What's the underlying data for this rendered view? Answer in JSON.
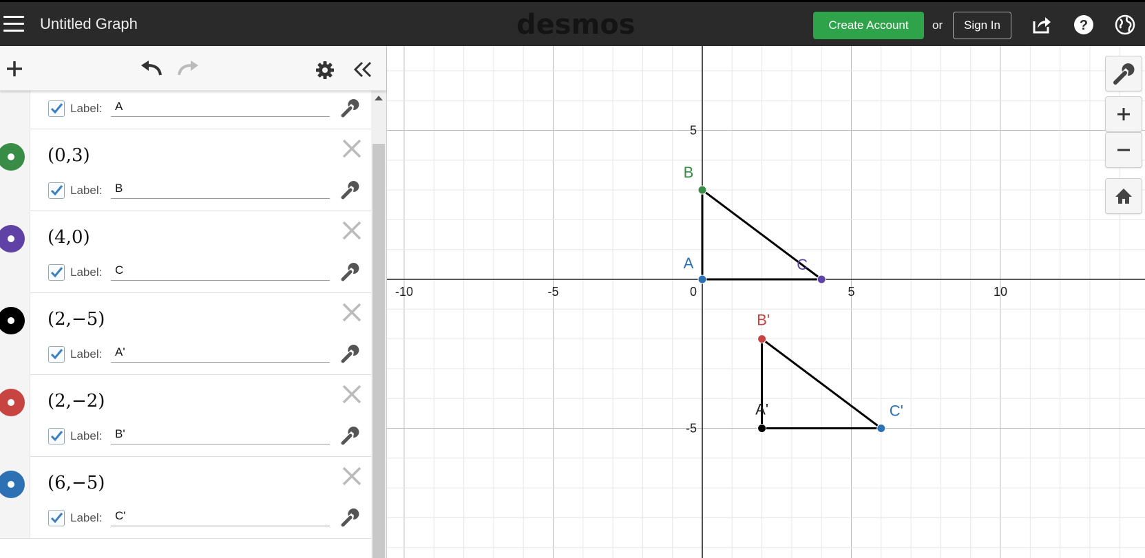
{
  "header": {
    "title": "Untitled Graph",
    "logo": "desmos",
    "create_account": "Create Account",
    "or": "or",
    "sign_in": "Sign In",
    "icons": [
      "menu-icon",
      "share-icon",
      "help-icon",
      "globe-icon"
    ]
  },
  "toolbar": {
    "icons": [
      "add-icon",
      "undo-icon",
      "redo-icon",
      "settings-icon",
      "collapse-icon"
    ]
  },
  "expressions": [
    {
      "expr": "",
      "label_text": "Label:",
      "label": "A",
      "color": "#2d70b3",
      "checked": true,
      "partial": true
    },
    {
      "expr": "(0,3)",
      "label_text": "Label:",
      "label": "B",
      "color": "#388c46",
      "checked": true
    },
    {
      "expr": "(4,0)",
      "label_text": "Label:",
      "label": "C",
      "color": "#6042a6",
      "checked": true
    },
    {
      "expr": "(2,−5)",
      "label_text": "Label:",
      "label": "A'",
      "color": "#000000",
      "checked": true
    },
    {
      "expr": "(2,−2)",
      "label_text": "Label:",
      "label": "B'",
      "color": "#c74440",
      "checked": true
    },
    {
      "expr": "(6,−5)",
      "label_text": "Label:",
      "label": "C'",
      "color": "#2d70b3",
      "checked": true
    }
  ],
  "graph": {
    "x_ticks": [
      "-10",
      "-5",
      "0",
      "5",
      "10"
    ],
    "y_ticks": [
      "5",
      "-5"
    ],
    "points": [
      {
        "label": "A",
        "x": 0,
        "y": 0,
        "color": "#2d70b3"
      },
      {
        "label": "B",
        "x": 0,
        "y": 3,
        "color": "#388c46"
      },
      {
        "label": "C",
        "x": 4,
        "y": 0,
        "color": "#6042a6"
      },
      {
        "label": "A'",
        "x": 2,
        "y": -5,
        "color": "#000000"
      },
      {
        "label": "B'",
        "x": 2,
        "y": -2,
        "color": "#c74440"
      },
      {
        "label": "C'",
        "x": 6,
        "y": -5,
        "color": "#2d70b3"
      }
    ],
    "buttons": [
      "wrench-icon",
      "zoom-in-icon",
      "zoom-out-icon",
      "home-icon"
    ]
  }
}
